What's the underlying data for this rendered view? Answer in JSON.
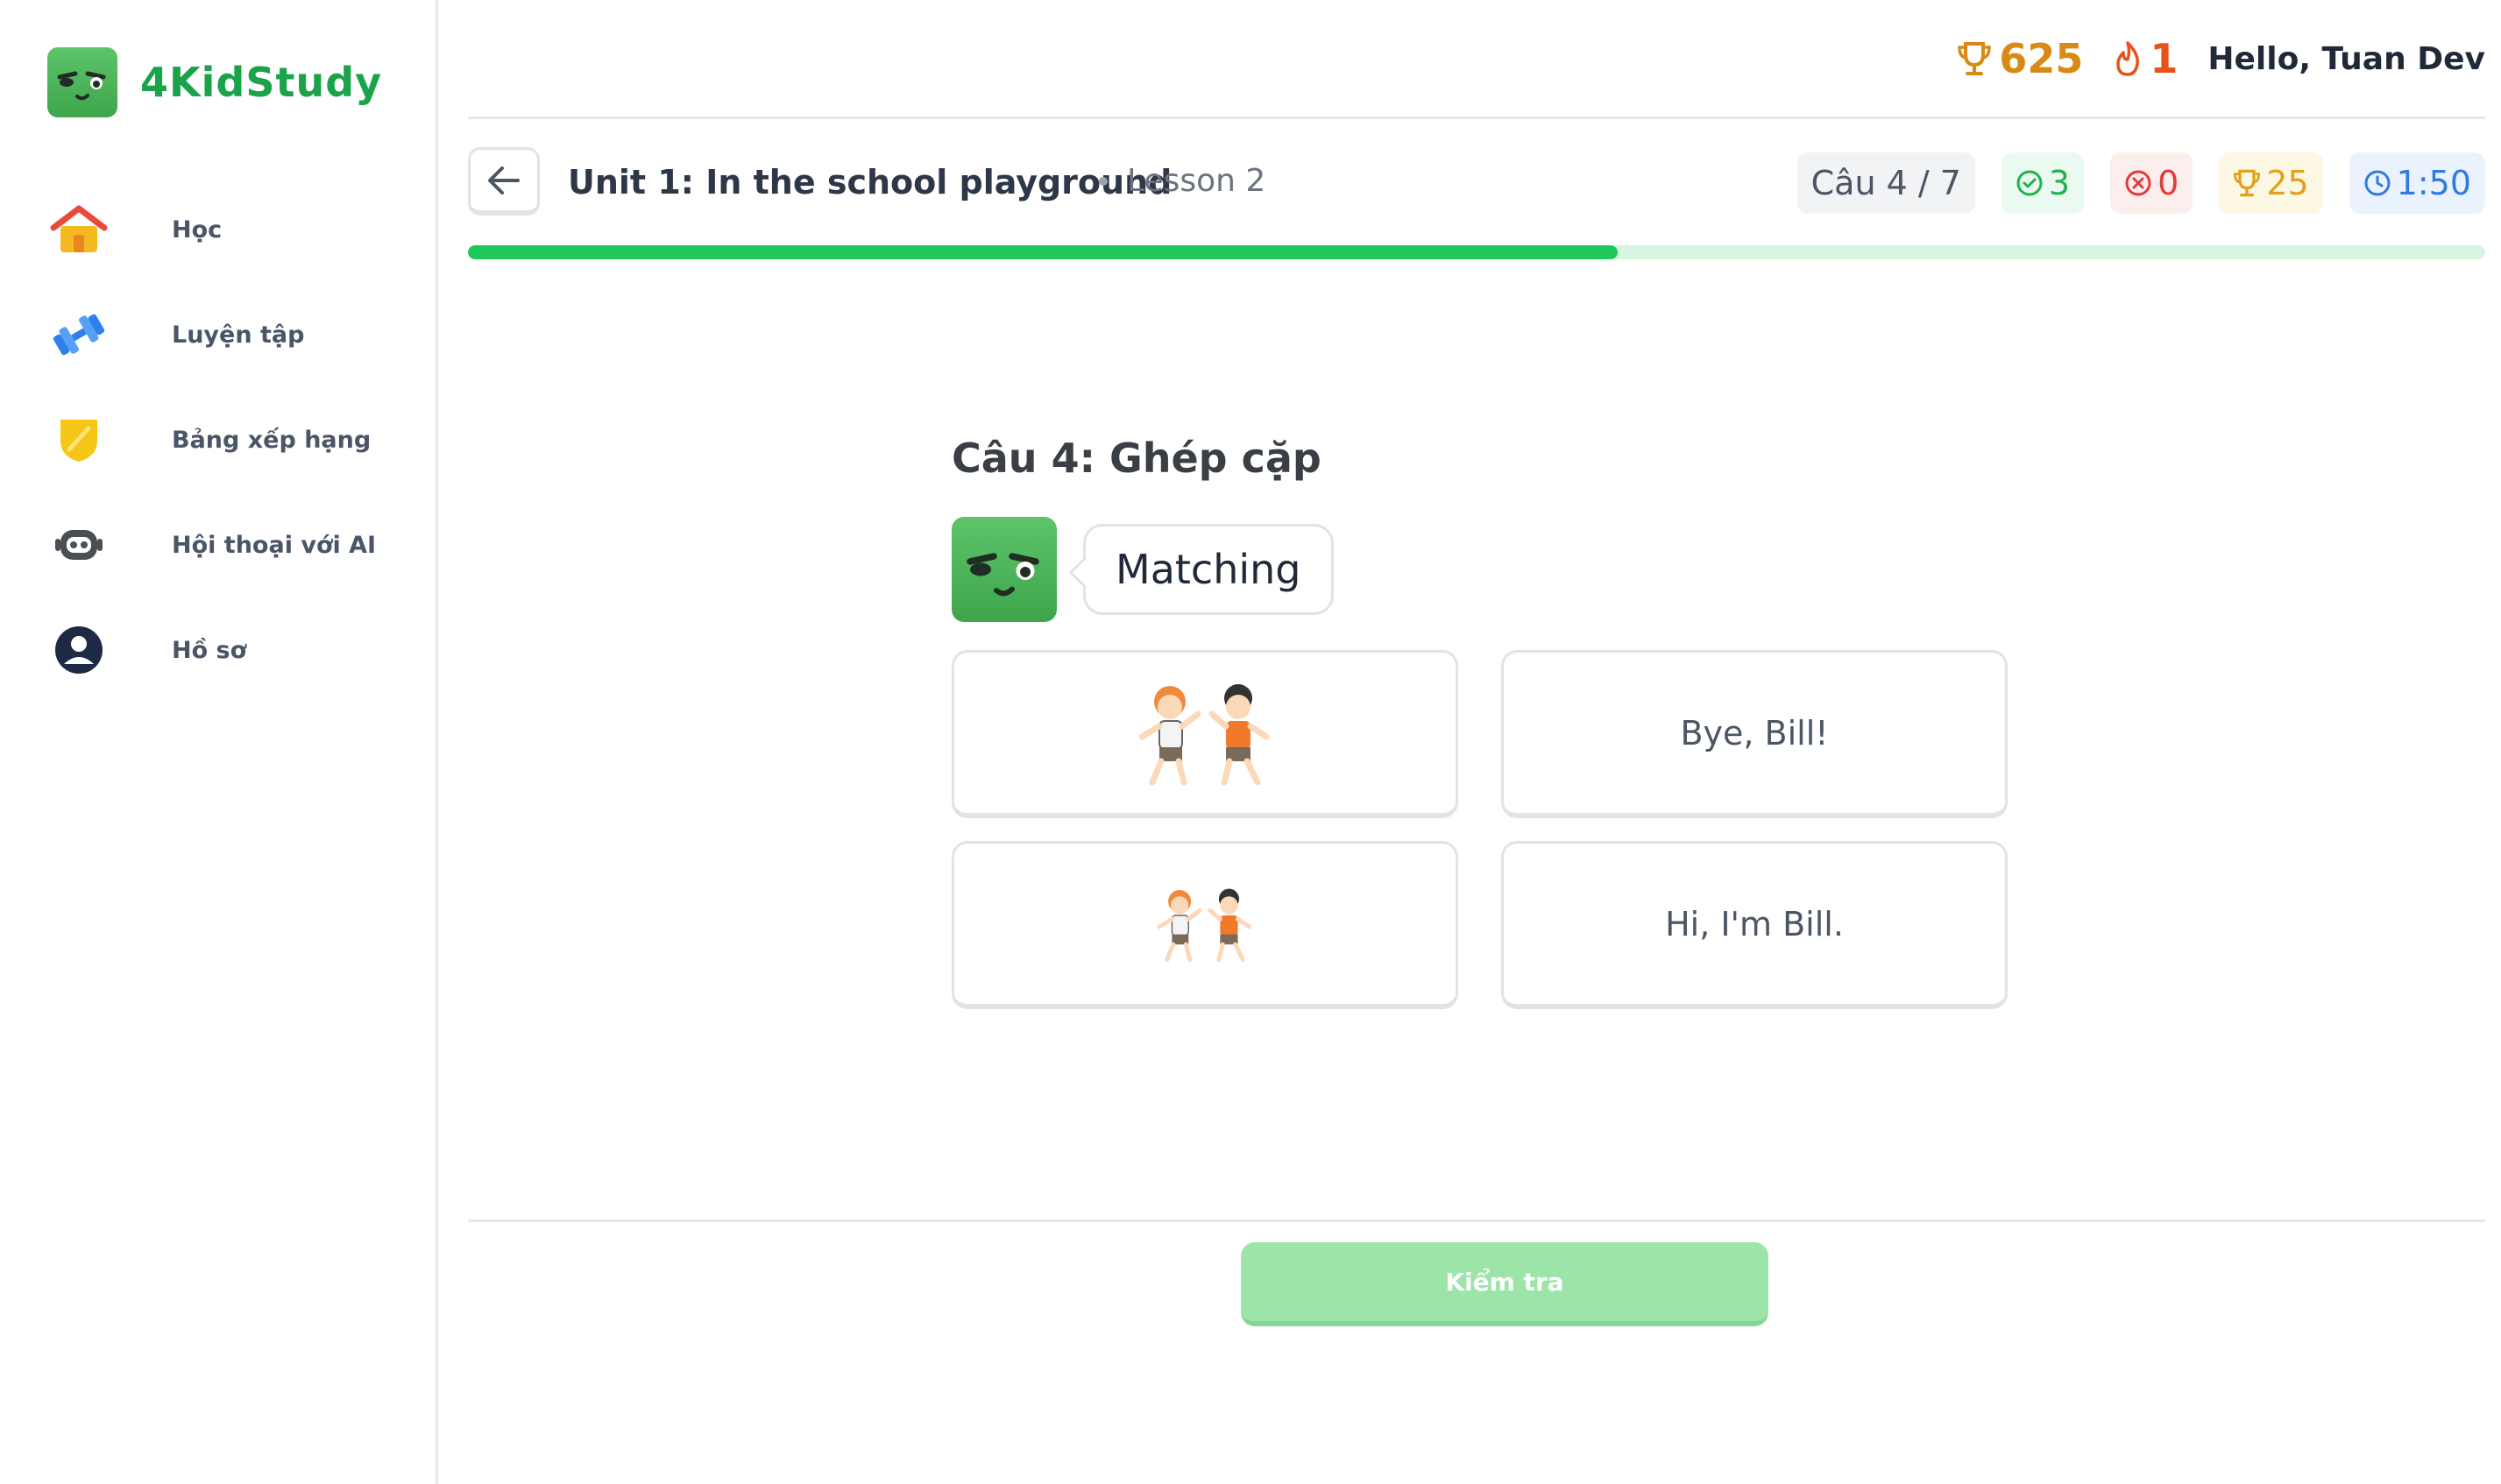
{
  "app": {
    "name": "4KidStudy"
  },
  "sidebar": {
    "items": [
      {
        "label": "Học",
        "icon": "home-icon"
      },
      {
        "label": "Luyện tập",
        "icon": "dumbbell-icon"
      },
      {
        "label": "Bảng xếp hạng",
        "icon": "shield-icon"
      },
      {
        "label": "Hội thoại với AI",
        "icon": "robot-icon"
      },
      {
        "label": "Hồ sơ",
        "icon": "profile-icon"
      }
    ]
  },
  "header": {
    "trophies": "625",
    "streak": "1",
    "greeting": "Hello, Tuan Dev"
  },
  "lesson": {
    "title": "Unit 1: In the school playground",
    "subtitle": "Lesson 2",
    "question_counter": "Câu 4 / 7",
    "correct": "3",
    "wrong": "0",
    "points": "25",
    "timer": "1:50",
    "progress": 0.57
  },
  "question": {
    "title": "Câu 4: Ghép cặp",
    "bubble": "Matching",
    "cards": [
      {
        "kind": "image",
        "image": "two-boys-waving-large"
      },
      {
        "kind": "text",
        "text": "Bye, Bill!"
      },
      {
        "kind": "image",
        "image": "two-boys-waving-small"
      },
      {
        "kind": "text",
        "text": "Hi, I'm Bill."
      }
    ]
  },
  "footer": {
    "check_label": "Kiểm tra"
  },
  "colors": {
    "brand": "#1aa34a",
    "progress": "#1ec75a",
    "check_button": "#9de4a9"
  }
}
